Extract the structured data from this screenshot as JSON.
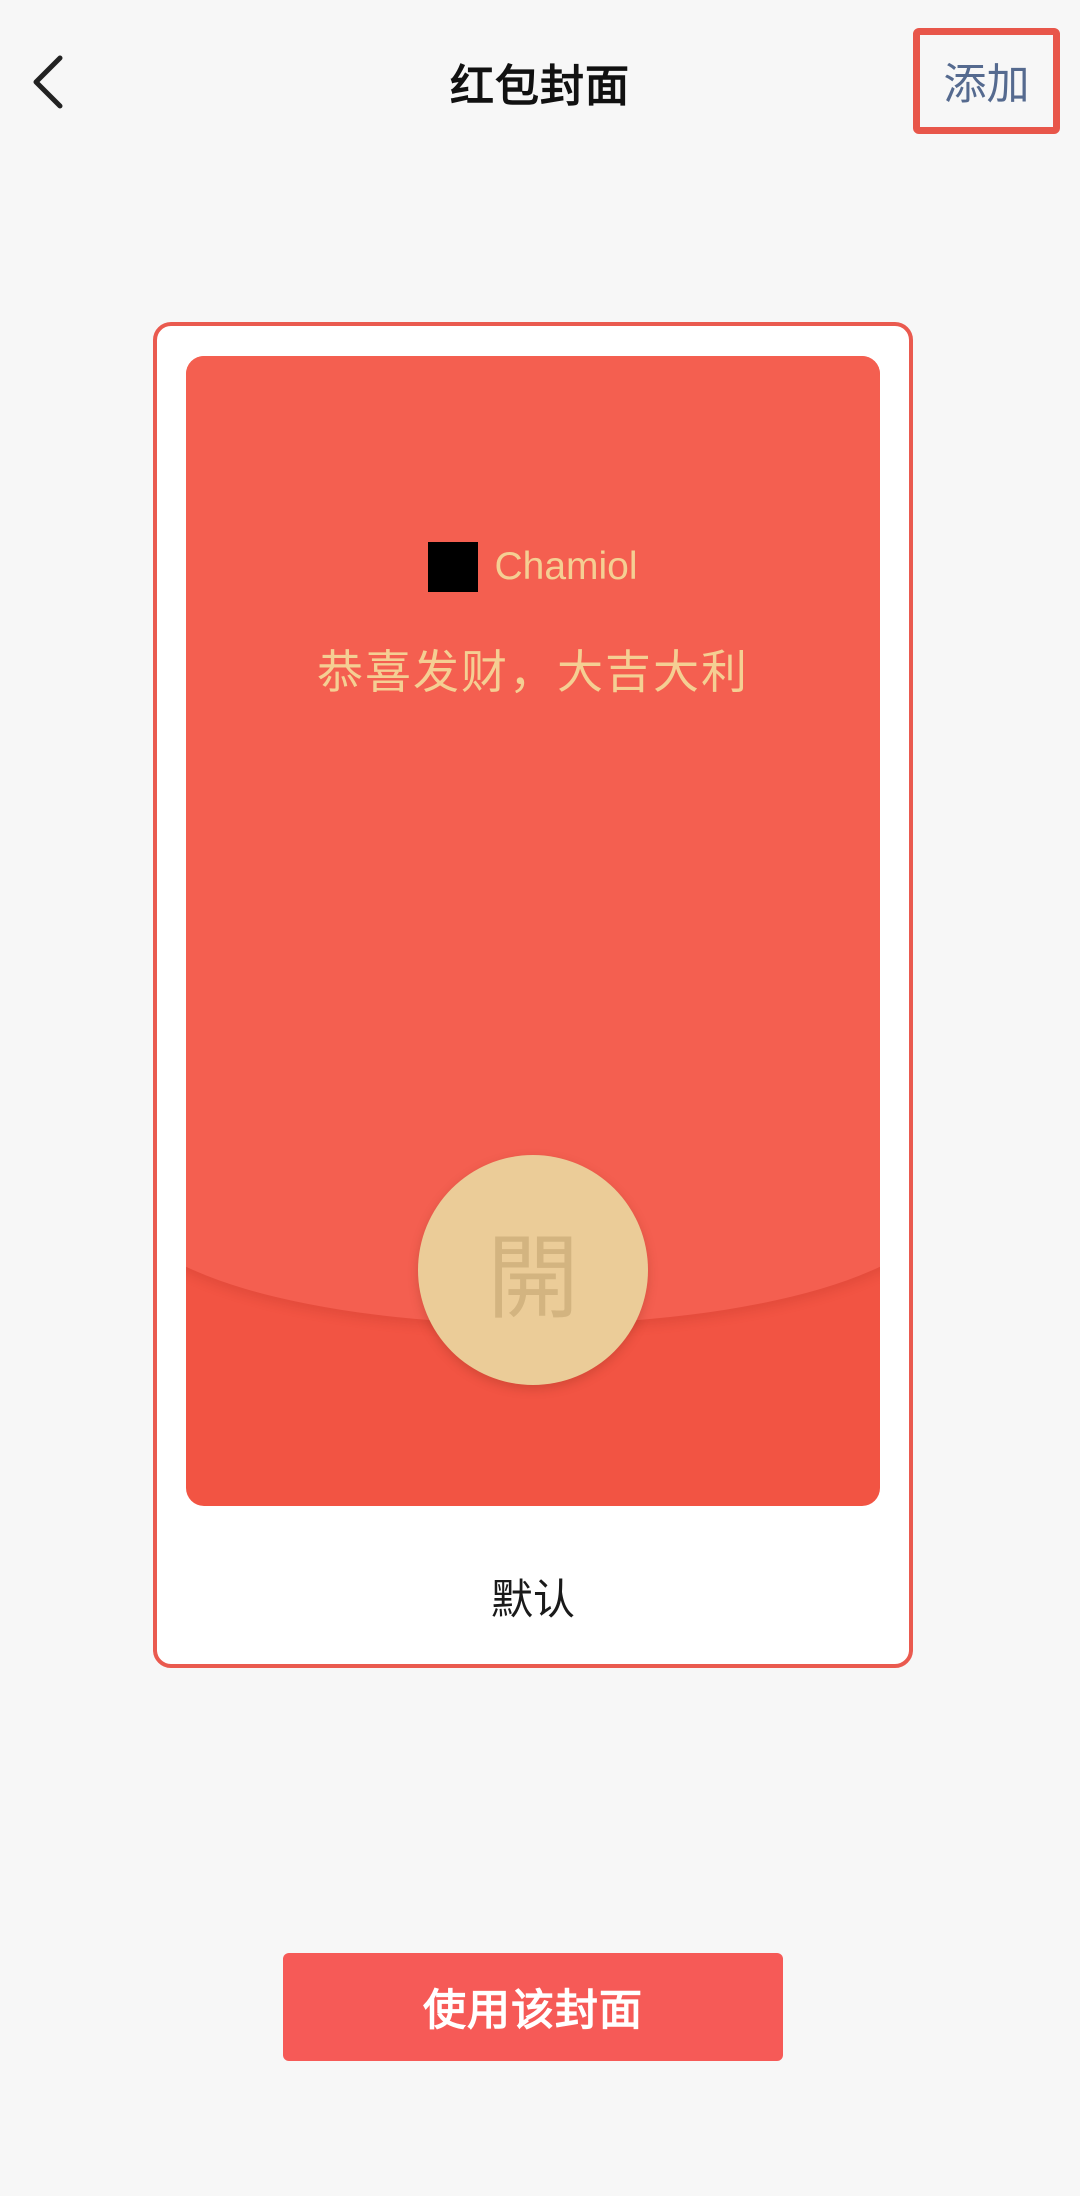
{
  "header": {
    "title": "红包封面",
    "back_icon": "chevron-left-icon",
    "add_label": "添加"
  },
  "cover": {
    "sender_name": "Chamiol",
    "blessing": "恭喜发财，大吉大利",
    "open_label": "開",
    "name": "默认"
  },
  "footer": {
    "use_label": "使用该封面"
  },
  "colors": {
    "accent_red": "#f65a57",
    "envelope_red": "#f25443",
    "gold": "#ebcc98",
    "link_blue": "#556a8f"
  }
}
